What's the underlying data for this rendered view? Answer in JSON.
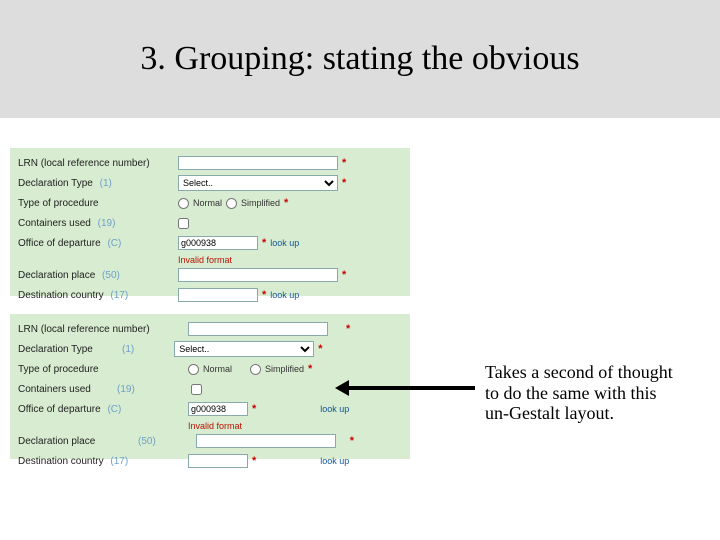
{
  "title": "3. Grouping: stating the obvious",
  "labels": {
    "lrn": "LRN (local reference number)",
    "declType": "Declaration Type",
    "procType": "Type of procedure",
    "containers": "Containers used",
    "officeDep": "Office of departure",
    "declPlace": "Declaration place",
    "destCountry": "Destination country"
  },
  "suffix": {
    "declType": "(1)",
    "containers": "(19)",
    "officeDep": "(C)",
    "declPlace": "(50)",
    "destCountry": "(17)"
  },
  "controls": {
    "selectPlaceholder": "Select..",
    "radioNormal": "Normal",
    "radioSimplified": "Simplified",
    "officeValue": "g000938",
    "lookup": "look up",
    "invalidFormat": "Invalid format",
    "asterisk": "*"
  },
  "caption": "Takes a second of thought to do the same with this un-Gestalt layout."
}
